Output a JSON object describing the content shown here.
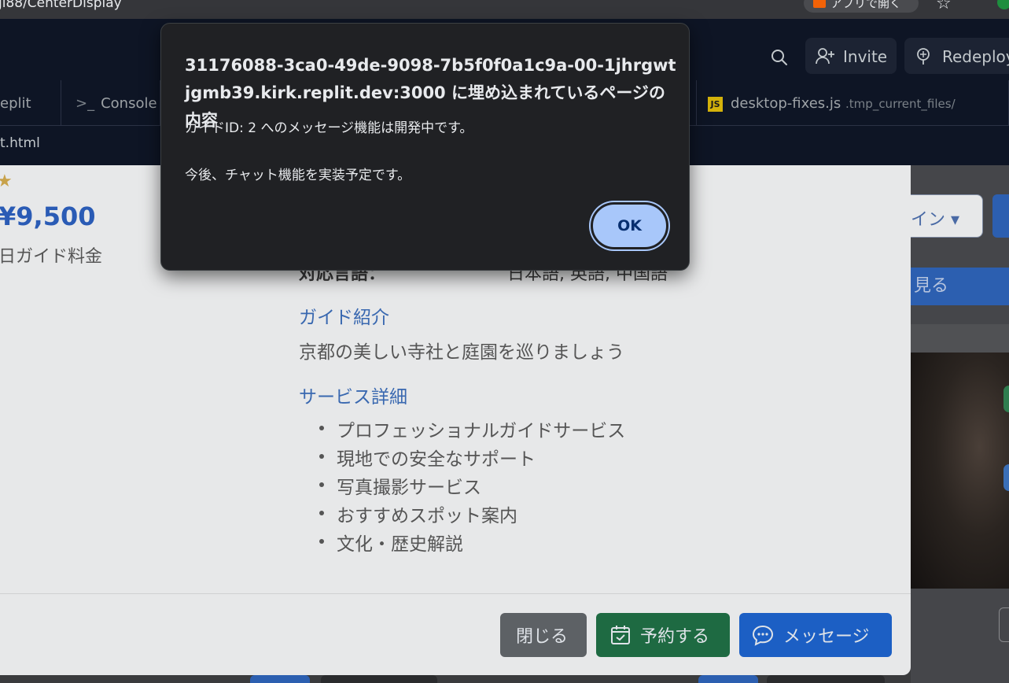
{
  "browser": {
    "url_fragment": "ji88/CenterDisplay",
    "open_in_app": "アプリで開く"
  },
  "replit": {
    "invite": "Invite",
    "redeploy": "Redeploy",
    "tabs": [
      {
        "label": "eplit"
      },
      {
        "label": "Console"
      },
      {
        "label": "desktop-fixes.js",
        "sub": ".tmp_current_files/",
        "badge": "JS"
      }
    ],
    "path": "t.html"
  },
  "guide_modal": {
    "price": "¥9,500",
    "price_label": "日ガイド料金",
    "language_label": "対応言語：",
    "language_value": "日本語, 英語, 中国語",
    "intro_heading": "ガイド紹介",
    "intro_text": "京都の美しい寺社と庭園を巡りましょう",
    "service_heading": "サービス詳細",
    "services": [
      "プロフェッショナルガイドサービス",
      "現地での安全なサポート",
      "写真撮影サービス",
      "おすすめスポット案内",
      "文化・歴史解説"
    ],
    "buttons": {
      "close": "閉じる",
      "reserve": "予約する",
      "message": "メッセージ"
    }
  },
  "right_panel": {
    "lang_select": "イン ▾",
    "blue_bar": "見る"
  },
  "alert": {
    "title": "31176088-3ca0-49de-9098-7b5f0f0a1c9a-00-1jhrgwtjgmb39.kirk.replit.dev:3000 に埋め込まれているページの内容",
    "line1": "ガイドID: 2 へのメッセージ機能は開発中です。",
    "line2": "今後、チャット機能を実装予定です。",
    "ok": "OK"
  }
}
